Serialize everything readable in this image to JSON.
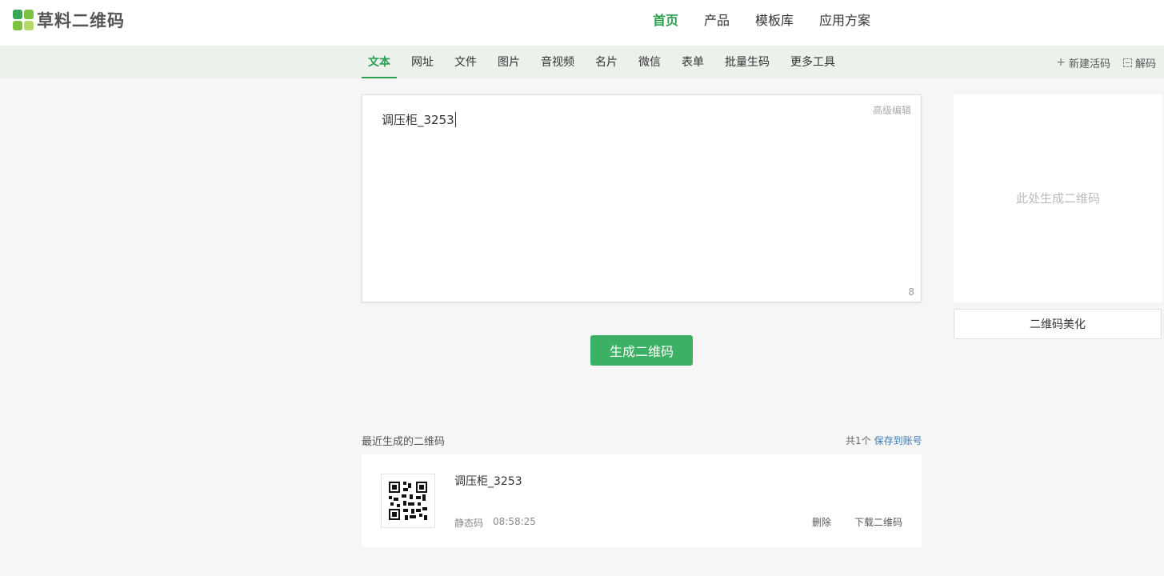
{
  "logo": {
    "text": "草料二维码"
  },
  "topnav": [
    "首页",
    "产品",
    "模板库",
    "应用方案"
  ],
  "tabs": [
    "文本",
    "网址",
    "文件",
    "图片",
    "音视频",
    "名片",
    "微信",
    "表单",
    "批量生码",
    "更多工具"
  ],
  "subnav_right": {
    "new_live": "新建活码",
    "decode": "解码"
  },
  "editor": {
    "advanced": "高级编辑",
    "text": "调压柜_3253",
    "count": "8"
  },
  "generate_button": "生成二维码",
  "preview": {
    "placeholder": "此处生成二维码",
    "beautify": "二维码美化"
  },
  "recent": {
    "title": "最近生成的二维码",
    "total": "共1个",
    "save": "保存到账号",
    "items": [
      {
        "name": "调压柜_3253",
        "type": "静态码",
        "time": "08:58:25",
        "delete": "删除",
        "download": "下载二维码"
      }
    ]
  },
  "colors": {
    "brand": "#3cb065",
    "active": "#2a9f4f",
    "link": "#3a7bbf"
  }
}
